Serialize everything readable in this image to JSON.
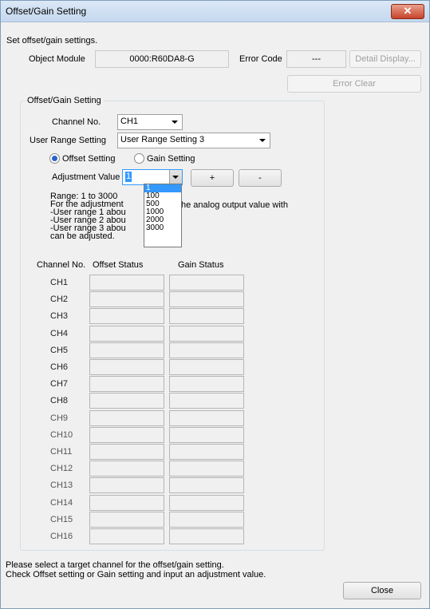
{
  "window": {
    "title": "Offset/Gain Setting",
    "close_icon": "close-icon"
  },
  "intro": "Set offset/gain settings.",
  "module": {
    "label": "Object Module",
    "value": "0000:R60DA8-G"
  },
  "error": {
    "label": "Error Code",
    "value": "---"
  },
  "buttons": {
    "detail_display": "Detail Display...",
    "error_clear": "Error Clear",
    "close": "Close",
    "plus": "+",
    "minus": "-"
  },
  "group": {
    "label": "Offset/Gain Setting",
    "channel_label": "Channel No.",
    "channel_value": "CH1",
    "range_label": "User Range Setting",
    "range_value": "User Range Setting 3",
    "offset_radio": "Offset Setting",
    "gain_radio": "Gain Setting",
    "adj_label": "Adjustment Value",
    "adj_value": "1",
    "adj_options": [
      "1",
      "100",
      "500",
      "1000",
      "2000",
      "3000"
    ],
    "info_lines": [
      "Range: 1 to 3000",
      "For the adjustment",
      "-User range 1 abou",
      "-User range 2 abou",
      "-User range 3 abou",
      "can be adjusted."
    ],
    "info_right": "he analog output value with"
  },
  "table": {
    "headers": [
      "Channel No.",
      "Offset Status",
      "Gain Status"
    ],
    "channels": [
      "CH1",
      "CH2",
      "CH3",
      "CH4",
      "CH5",
      "CH6",
      "CH7",
      "CH8",
      "CH9",
      "CH10",
      "CH11",
      "CH12",
      "CH13",
      "CH14",
      "CH15",
      "CH16"
    ]
  },
  "footer": [
    "Please select a target channel for the offset/gain setting.",
    "Check Offset setting or Gain setting and input an adjustment value."
  ]
}
